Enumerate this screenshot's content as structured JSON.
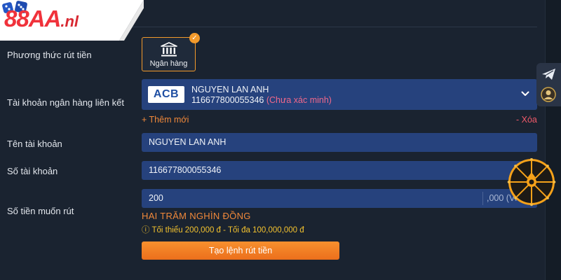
{
  "brand": {
    "logo_main": "88AA",
    "logo_sub": ".nl",
    "logo_color": "#f0323b"
  },
  "form": {
    "withdraw_method": {
      "label": "Phương thức rút tiền",
      "option_label": "Ngân hàng",
      "option_icon": "bank-icon",
      "selected": true
    },
    "linked_account": {
      "label": "Tài khoản ngân hàng liên kết",
      "bank_logo": "ACB",
      "account_name": "NGUYEN LAN ANH",
      "account_number": "116677800055346",
      "status": "(Chưa xác minh)",
      "add_new": "+ Thêm mới",
      "delete": "- Xóa"
    },
    "account_name": {
      "label": "Tên tài khoản",
      "value": "NGUYEN LAN ANH"
    },
    "account_number": {
      "label": "Số tài khoản",
      "value": "116677800055346"
    },
    "amount": {
      "label": "Số tiền muốn rút",
      "value": "200",
      "suffix": ",000 (VN",
      "words": "HAI TRĂM NGHÌN ĐỒNG",
      "limits": "ⓘ Tối thiểu 200,000 đ - Tối đa 100,000,000 đ"
    },
    "submit_label": "Tạo lệnh rút tiền"
  },
  "side_tools": [
    {
      "name": "telegram-icon"
    },
    {
      "name": "avatar-icon"
    }
  ],
  "colors": {
    "background": "#1a2330",
    "field_bg": "#26427d",
    "accent_orange": "#f39a2b",
    "button": "#ec6f1c",
    "warning_yellow": "#f3c22e",
    "unverified_pink": "#f0688a"
  }
}
